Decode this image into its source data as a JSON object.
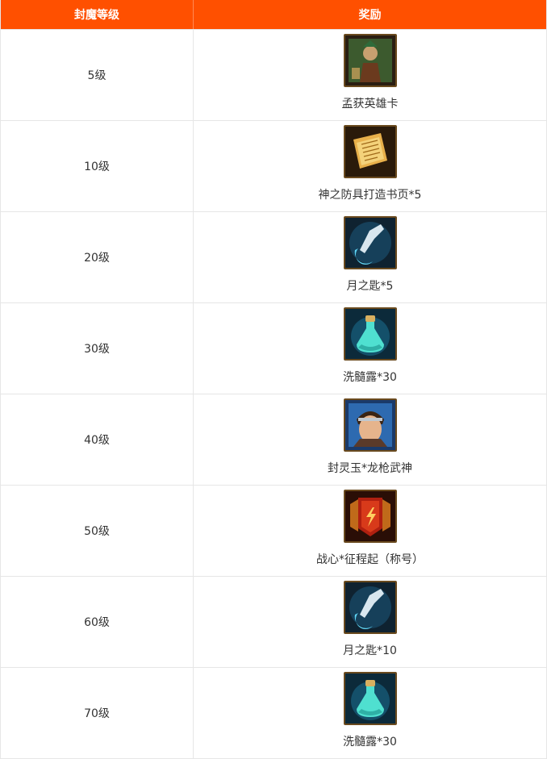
{
  "header": {
    "level_col": "封魔等级",
    "reward_col": "奖励"
  },
  "rows": [
    {
      "level": "5级",
      "reward": "孟获英雄卡",
      "icon": "hero-card-icon"
    },
    {
      "level": "10级",
      "reward": "神之防具打造书页*5",
      "icon": "scroll-page-icon"
    },
    {
      "level": "20级",
      "reward": "月之匙*5",
      "icon": "moon-key-icon"
    },
    {
      "level": "30级",
      "reward": "洗髓露*30",
      "icon": "potion-bottle-icon"
    },
    {
      "level": "40级",
      "reward": "封灵玉*龙枪武神",
      "icon": "portrait-jade-icon"
    },
    {
      "level": "50级",
      "reward": "战心*征程起（称号）",
      "icon": "title-banner-icon"
    },
    {
      "level": "60级",
      "reward": "月之匙*10",
      "icon": "moon-key-icon"
    },
    {
      "level": "70级",
      "reward": "洗髓露*30",
      "icon": "potion-bottle-icon"
    }
  ]
}
